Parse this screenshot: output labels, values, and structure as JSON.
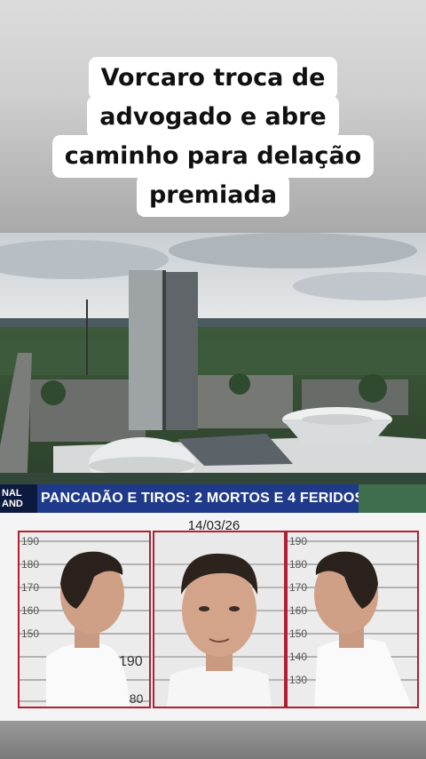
{
  "headline": {
    "lines": [
      "Vorcaro troca de",
      "advogado e abre",
      "caminho para delação",
      "premiada"
    ]
  },
  "banner": {
    "logo_line1": "NAL",
    "logo_line2": "AND",
    "text": "PANCADÃO E TIROS: 2 MORTOS E 4 FERIDOS"
  },
  "mugshots": {
    "date": "14/03/26",
    "left_ticks": [
      "190",
      "180",
      "170",
      "160",
      "150"
    ],
    "left_bottom": [
      "190",
      "180"
    ],
    "right_ticks": [
      "190",
      "180",
      "170",
      "160",
      "150",
      "140",
      "130"
    ]
  },
  "colors": {
    "banner": "#1f3a8a",
    "frame": "#b02030"
  }
}
